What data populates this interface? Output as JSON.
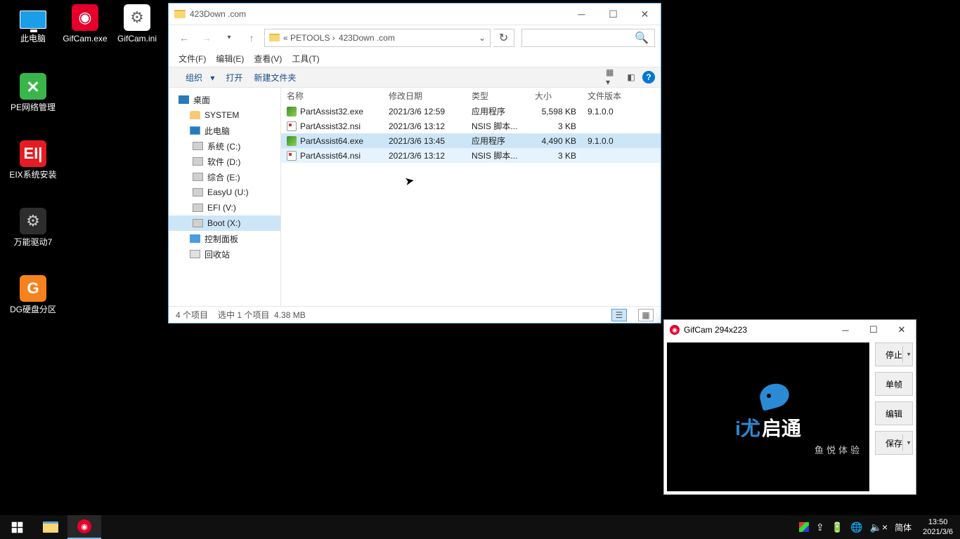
{
  "desktop": {
    "icons": [
      {
        "label": "此电脑"
      },
      {
        "label": "GifCam.exe"
      },
      {
        "label": "GifCam.ini"
      },
      {
        "label": "PE网络管理"
      },
      {
        "label": "EIX系统安装",
        "badge": "EI|"
      },
      {
        "label": "万能驱动7"
      },
      {
        "label": "DG硬盘分区",
        "badge": "G"
      }
    ]
  },
  "explorer": {
    "title": "423Down .com",
    "breadcrumb_prefix": "«   PETOOLS  ›",
    "breadcrumb_current": "423Down .com",
    "menu": [
      "文件(F)",
      "编辑(E)",
      "查看(V)",
      "工具(T)"
    ],
    "toolbar": {
      "organize": "组织",
      "open": "打开",
      "newfolder": "新建文件夹"
    },
    "tree": [
      {
        "label": "桌面",
        "cls": "tic-desktop"
      },
      {
        "label": "SYSTEM",
        "cls": "tic-user",
        "sub": true
      },
      {
        "label": "此电脑",
        "cls": "tic-pc",
        "sub": true
      },
      {
        "label": "系统 (C:)",
        "cls": "tic-drv",
        "sub": true,
        "deep": true
      },
      {
        "label": "软件 (D:)",
        "cls": "tic-drv",
        "sub": true,
        "deep": true
      },
      {
        "label": "综合 (E:)",
        "cls": "tic-drv",
        "sub": true,
        "deep": true
      },
      {
        "label": "EasyU (U:)",
        "cls": "tic-drv",
        "sub": true,
        "deep": true
      },
      {
        "label": "EFI (V:)",
        "cls": "tic-drv",
        "sub": true,
        "deep": true
      },
      {
        "label": "Boot (X:)",
        "cls": "tic-drv",
        "sub": true,
        "deep": true,
        "sel": true
      },
      {
        "label": "控制面板",
        "cls": "tic-cp",
        "sub": true
      },
      {
        "label": "回收站",
        "cls": "tic-bin",
        "sub": true
      }
    ],
    "cols": {
      "name": "名称",
      "date": "修改日期",
      "type": "类型",
      "size": "大小",
      "ver": "文件版本"
    },
    "rows": [
      {
        "name": "PartAssist32.exe",
        "date": "2021/3/6 12:59",
        "type": "应用程序",
        "size": "5,598 KB",
        "ver": "9.1.0.0",
        "ic": "fic-exe"
      },
      {
        "name": "PartAssist32.nsi",
        "date": "2021/3/6 13:12",
        "type": "NSIS 脚本...",
        "size": "3 KB",
        "ver": "",
        "ic": "fic-nsi"
      },
      {
        "name": "PartAssist64.exe",
        "date": "2021/3/6 13:45",
        "type": "应用程序",
        "size": "4,490 KB",
        "ver": "9.1.0.0",
        "ic": "fic-exe",
        "sel": true
      },
      {
        "name": "PartAssist64.nsi",
        "date": "2021/3/6 13:12",
        "type": "NSIS 脚本...",
        "size": "3 KB",
        "ver": "",
        "ic": "fic-nsi",
        "hover": true
      }
    ],
    "status": {
      "count": "4 个项目",
      "sel": "选中 1 个项目",
      "size": "4.38 MB"
    }
  },
  "gifcam": {
    "title": "GifCam 294x223",
    "buttons": {
      "stop": "停止",
      "frame": "单帧",
      "edit": "编辑",
      "save": "保存"
    },
    "capture": {
      "brand1": "i尤",
      "brand2": "启通",
      "slogan": "鱼悦体验"
    }
  },
  "taskbar": {
    "lang": "简体",
    "time": "13:50",
    "date": "2021/3/6"
  }
}
